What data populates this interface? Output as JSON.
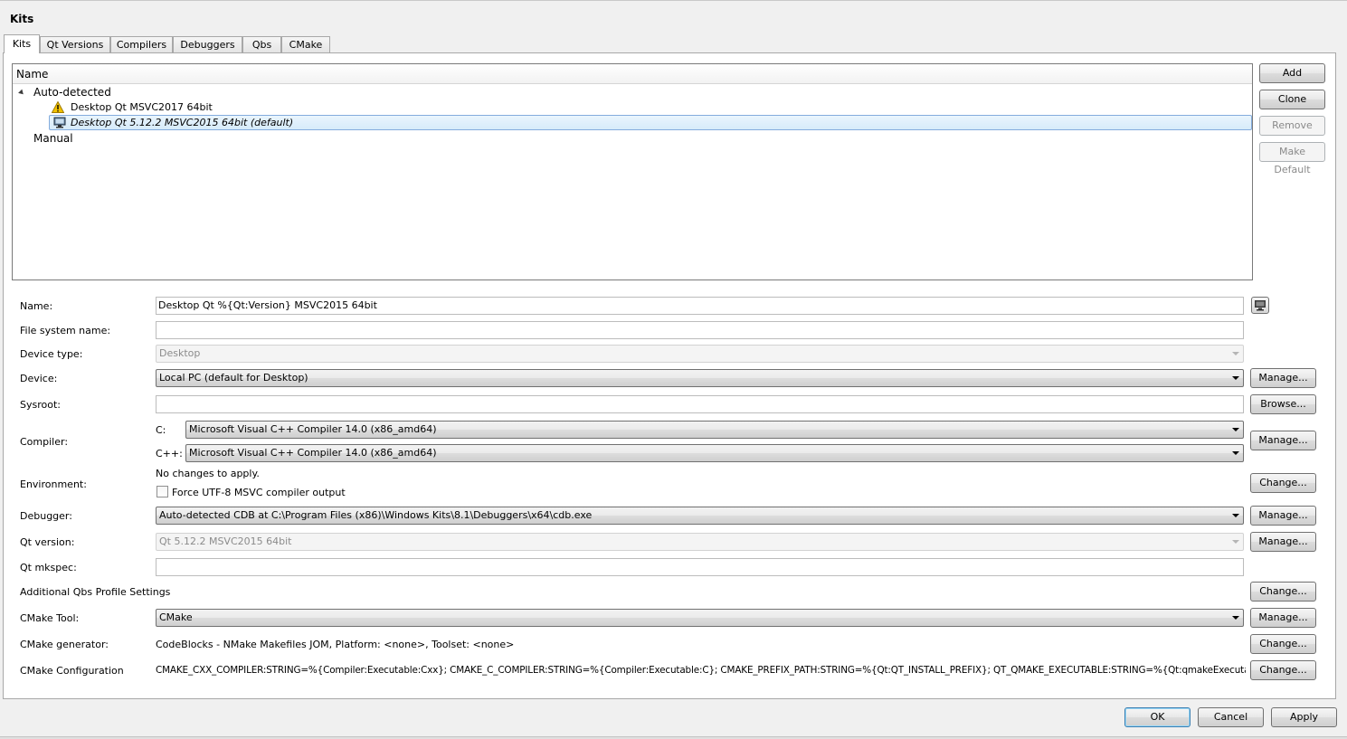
{
  "window": {
    "title": "Kits"
  },
  "tabs": [
    {
      "label": "Kits",
      "active": true
    },
    {
      "label": "Qt Versions"
    },
    {
      "label": "Compilers"
    },
    {
      "label": "Debuggers"
    },
    {
      "label": "Qbs"
    },
    {
      "label": "CMake"
    }
  ],
  "tree": {
    "header": "Name",
    "groups": {
      "auto": "Auto-detected",
      "manual": "Manual"
    },
    "items": [
      {
        "label": "Desktop Qt  MSVC2017 64bit",
        "icon": "warning-icon"
      },
      {
        "label": "Desktop Qt 5.12.2 MSVC2015 64bit (default)",
        "icon": "monitor-icon",
        "selected": true
      }
    ]
  },
  "side_buttons": {
    "add": "Add",
    "clone": "Clone",
    "remove": "Remove",
    "make_default": "Make Default"
  },
  "form": {
    "name": {
      "label": "Name:",
      "value": "Desktop Qt %{Qt:Version} MSVC2015 64bit"
    },
    "file_system_name": {
      "label": "File system name:",
      "value": ""
    },
    "device_type": {
      "label": "Device type:",
      "value": "Desktop"
    },
    "device": {
      "label": "Device:",
      "value": "Local PC (default for Desktop)",
      "button": "Manage..."
    },
    "sysroot": {
      "label": "Sysroot:",
      "value": "",
      "button": "Browse..."
    },
    "compiler": {
      "label": "Compiler:",
      "c_label": "C:",
      "c_value": "Microsoft Visual C++ Compiler 14.0 (x86_amd64)",
      "cpp_label": "C++:",
      "cpp_value": "Microsoft Visual C++ Compiler 14.0 (x86_amd64)",
      "button": "Manage..."
    },
    "environment": {
      "label": "Environment:",
      "status": "No changes to apply.",
      "checkbox_label": "Force UTF-8 MSVC compiler output",
      "button": "Change..."
    },
    "debugger": {
      "label": "Debugger:",
      "value": "Auto-detected CDB at C:\\Program Files (x86)\\Windows Kits\\8.1\\Debuggers\\x64\\cdb.exe",
      "button": "Manage..."
    },
    "qt_version": {
      "label": "Qt version:",
      "value": "Qt 5.12.2 MSVC2015 64bit",
      "button": "Manage..."
    },
    "qt_mkspec": {
      "label": "Qt mkspec:",
      "value": ""
    },
    "qbs_profile": {
      "label": "Additional Qbs Profile Settings",
      "button": "Change..."
    },
    "cmake_tool": {
      "label": "CMake Tool:",
      "value": "CMake",
      "button": "Manage..."
    },
    "cmake_generator": {
      "label": "CMake generator:",
      "value": "CodeBlocks - NMake Makefiles JOM, Platform: <none>, Toolset: <none>",
      "button": "Change..."
    },
    "cmake_configuration": {
      "label": "CMake Configuration",
      "value": "CMAKE_CXX_COMPILER:STRING=%{Compiler:Executable:Cxx}; CMAKE_C_COMPILER:STRING=%{Compiler:Executable:C}; CMAKE_PREFIX_PATH:STRING=%{Qt:QT_INSTALL_PREFIX}; QT_QMAKE_EXECUTABLE:STRING=%{Qt:qmakeExecutable}",
      "button": "Change..."
    }
  },
  "dialog_buttons": {
    "ok": "OK",
    "cancel": "Cancel",
    "apply": "Apply"
  },
  "colors": {
    "selection_border": "#84acdd",
    "warning": "#f2c200",
    "default_button_border": "#3c7fb1"
  }
}
